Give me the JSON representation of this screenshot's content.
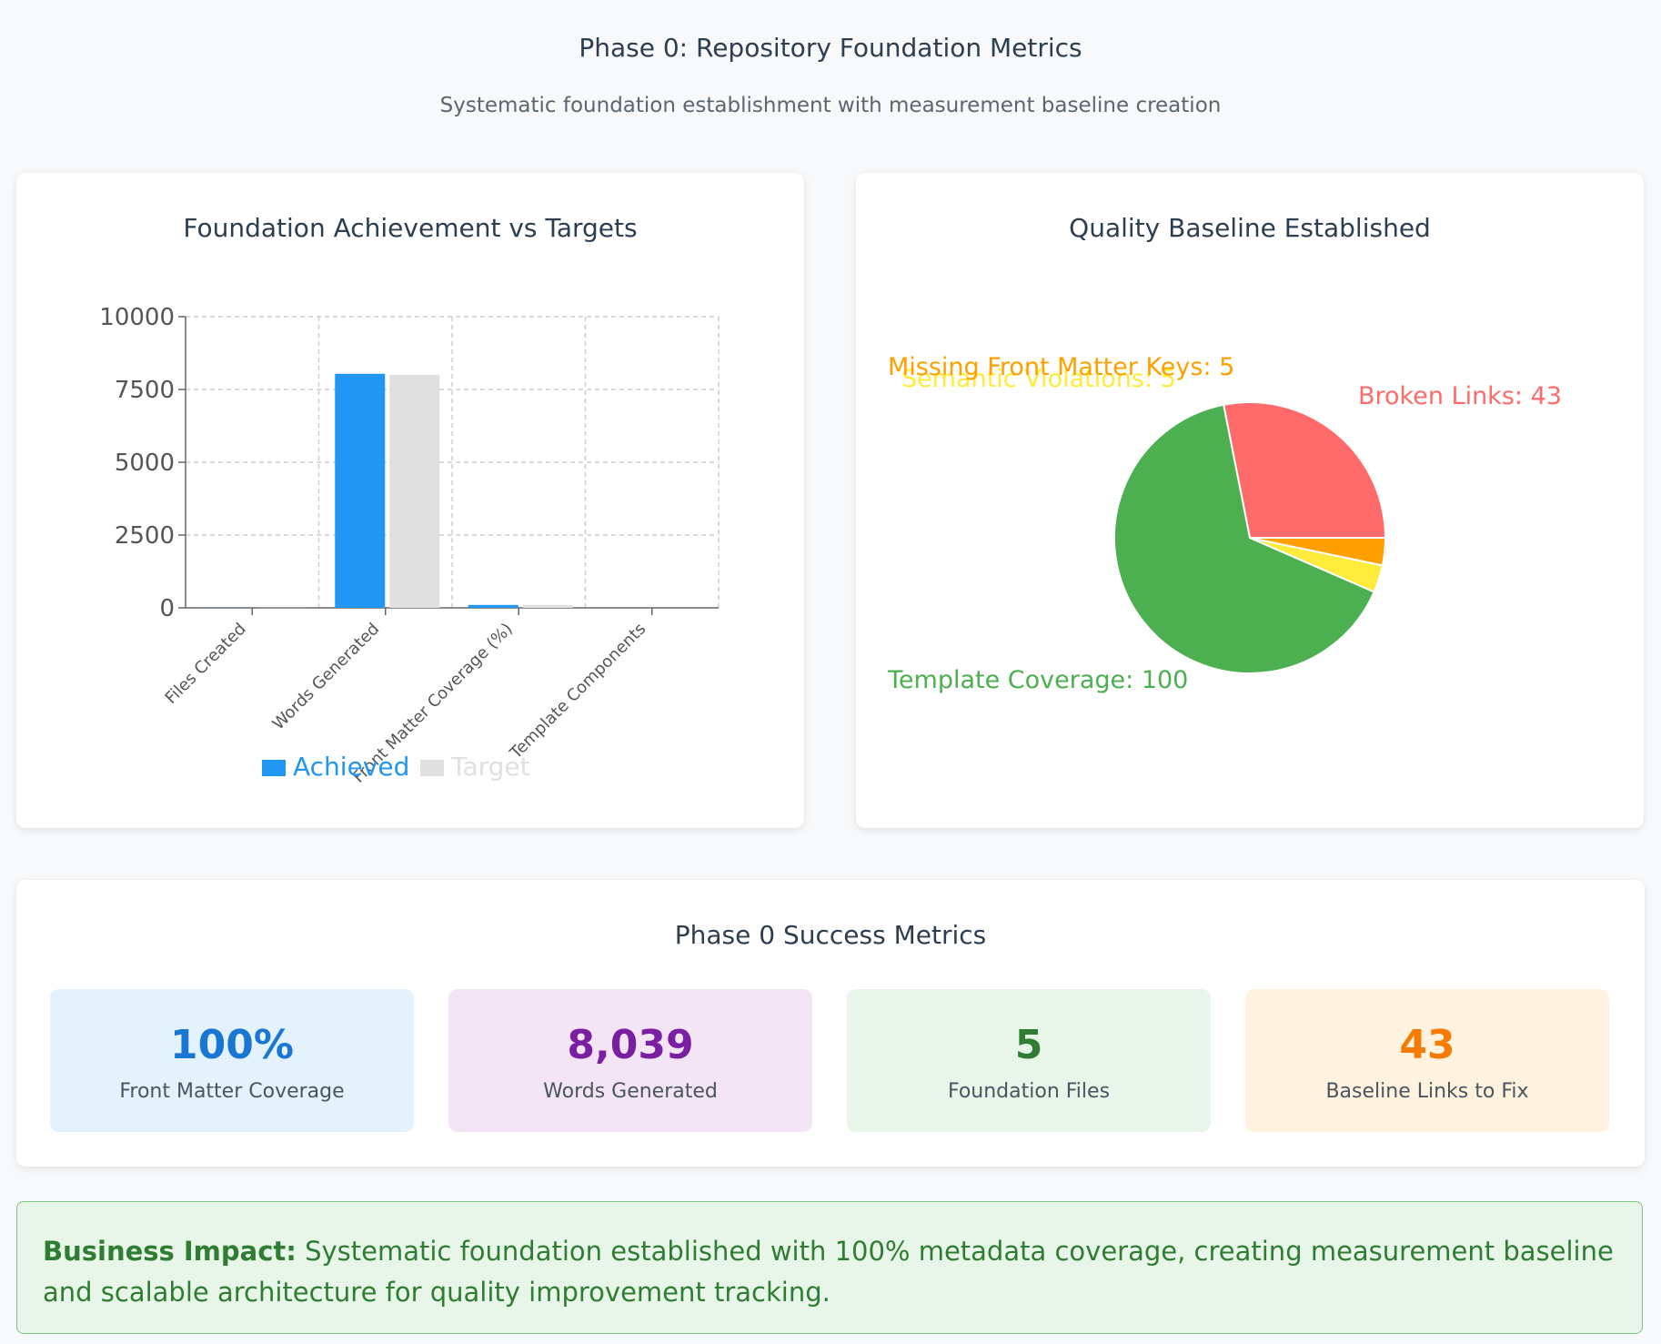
{
  "header": {
    "title": "Phase 0: Repository Foundation Metrics",
    "subtitle": "Systematic foundation establishment with measurement baseline creation"
  },
  "chart_data": [
    {
      "type": "bar",
      "title": "Foundation Achievement vs Targets",
      "categories": [
        "Files Created",
        "Words Generated",
        "Front Matter Coverage (%)",
        "Template Components"
      ],
      "series": [
        {
          "name": "Achieved",
          "values": [
            5,
            8039,
            100,
            0
          ],
          "color": "#2196f3"
        },
        {
          "name": "Target",
          "values": [
            5,
            8000,
            100,
            0
          ],
          "color": "#e0e0e0"
        }
      ],
      "yticks": [
        0,
        2500,
        5000,
        7500,
        10000
      ],
      "ylim": [
        0,
        10000
      ],
      "grid": true,
      "legend": "bottom"
    },
    {
      "type": "pie",
      "title": "Quality Baseline Established",
      "slices": [
        {
          "label": "Broken Links: 43",
          "value": 43,
          "color": "#ff6b6b"
        },
        {
          "label": "Template Coverage: 100",
          "value": 100,
          "color": "#4caf50"
        },
        {
          "label": "Semantic Violations: 5",
          "value": 5,
          "color": "#ffeb3b"
        },
        {
          "label": "Missing Front Matter Keys: 5",
          "value": 5,
          "color": "#ffa000"
        }
      ]
    }
  ],
  "metrics": {
    "title": "Phase 0 Success Metrics",
    "tiles": [
      {
        "value": "100%",
        "label": "Front Matter Coverage",
        "color": "#1976d2",
        "bg": "#e3f2fd"
      },
      {
        "value": "8,039",
        "label": "Words Generated",
        "color": "#7b1fa2",
        "bg": "#f3e5f5"
      },
      {
        "value": "5",
        "label": "Foundation Files",
        "color": "#2e7d32",
        "bg": "#e8f5e9"
      },
      {
        "value": "43",
        "label": "Baseline Links to Fix",
        "color": "#f57c00",
        "bg": "#fff3e0"
      }
    ]
  },
  "impact": {
    "label": "Business Impact:",
    "text": "Systematic foundation established with 100% metadata coverage, creating measurement baseline and scalable architecture for quality improvement tracking."
  }
}
